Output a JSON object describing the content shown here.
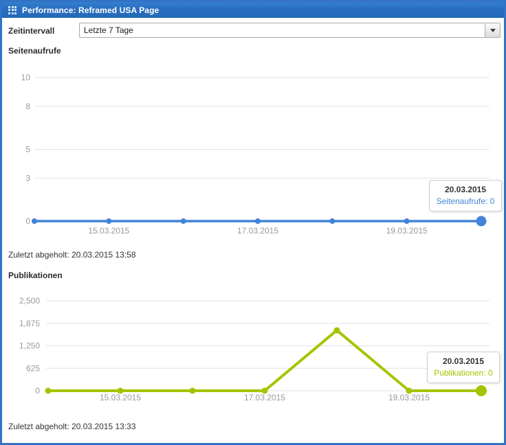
{
  "window": {
    "title": "Performance: Reframed USA Page"
  },
  "controls": {
    "zeitintervall_label": "Zeitintervall",
    "zeitintervall_value": "Letzte 7 Tage"
  },
  "chart_data": [
    {
      "type": "line",
      "title": "Seitenaufrufe",
      "series_color": "#4184d9",
      "grid": true,
      "legend": "none",
      "x": [
        "14.03.2015",
        "15.03.2015",
        "16.03.2015",
        "17.03.2015",
        "18.03.2015",
        "19.03.2015",
        "20.03.2015"
      ],
      "values": [
        0,
        0,
        0,
        0,
        0,
        0,
        0
      ],
      "ylim": [
        0,
        10
      ],
      "yticks": [
        {
          "v": 0,
          "label": "0"
        },
        {
          "v": 3,
          "label": "3"
        },
        {
          "v": 5,
          "label": "5"
        },
        {
          "v": 8,
          "label": "8"
        },
        {
          "v": 10,
          "label": "10"
        }
      ],
      "xtick_labels": [
        {
          "index": 1,
          "label": "15.03.2015"
        },
        {
          "index": 3,
          "label": "17.03.2015"
        },
        {
          "index": 5,
          "label": "19.03.2015"
        }
      ],
      "highlight_index": 6,
      "tooltip": {
        "date": "20.03.2015",
        "text": "Seitenaufrufe: 0"
      },
      "last_fetched_label": "Zuletzt abgeholt:",
      "last_fetched_value": "20.03.2015 13:58"
    },
    {
      "type": "line",
      "title": "Publikationen",
      "series_color": "#a5c400",
      "grid": true,
      "legend": "none",
      "x": [
        "14.03.2015",
        "15.03.2015",
        "16.03.2015",
        "17.03.2015",
        "18.03.2015",
        "19.03.2015",
        "20.03.2015"
      ],
      "values": [
        0,
        0,
        0,
        0,
        1680,
        0,
        0
      ],
      "ylim": [
        0,
        2500
      ],
      "yticks": [
        {
          "v": 0,
          "label": "0"
        },
        {
          "v": 625,
          "label": "625"
        },
        {
          "v": 1250,
          "label": "1,250"
        },
        {
          "v": 1875,
          "label": "1,875"
        },
        {
          "v": 2500,
          "label": "2,500"
        }
      ],
      "xtick_labels": [
        {
          "index": 1,
          "label": "15.03.2015"
        },
        {
          "index": 3,
          "label": "17.03.2015"
        },
        {
          "index": 5,
          "label": "19.03.2015"
        }
      ],
      "highlight_index": 6,
      "tooltip": {
        "date": "20.03.2015",
        "text": "Publikationen: 0"
      },
      "last_fetched_label": "Zuletzt abgeholt:",
      "last_fetched_value": "20.03.2015 13:33"
    }
  ],
  "colors": {
    "header_blue": "#2a70c1",
    "border_blue": "#3273c5",
    "gridline": "#e2e2e2",
    "axis_text": "#999999"
  }
}
